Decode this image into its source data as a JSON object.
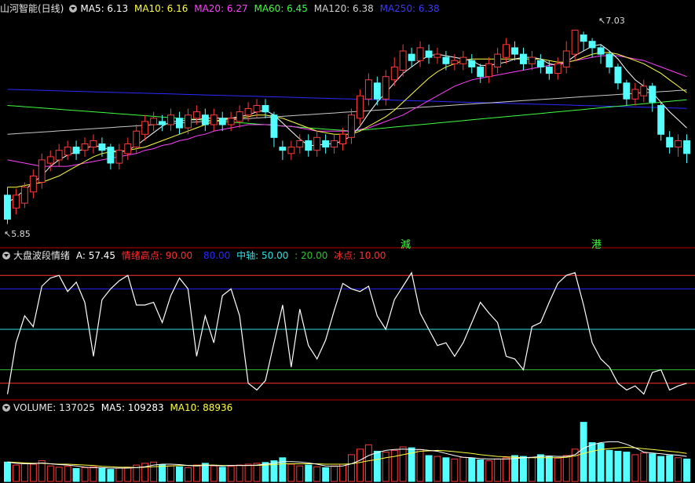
{
  "colors": {
    "up": "#ff3b3b",
    "down": "#54ffff",
    "ma5": "#ffffff",
    "ma10": "#ffff40",
    "ma20": "#ff40ff",
    "ma60": "#40ff40",
    "ma120": "#c8c8c8",
    "ma250": "#2a2aff",
    "line": "#ffffff",
    "hi": "#ff3030",
    "blue": "#2020ff",
    "mid": "#30e0e0",
    "green": "#30c030",
    "ice": "#ff3030"
  },
  "price_header": {
    "title": "山河智能(日线)",
    "ma5": "MA5: 6.13",
    "ma10": "MA10: 6.16",
    "ma20": "MA20: 6.27",
    "ma60": "MA60: 6.45",
    "ma120": "MA120: 6.38",
    "ma250": "MA250: 6.38"
  },
  "osc_header": {
    "title": "大盘波段情绪",
    "a": "A: 57.45",
    "high": "情绪高点: 90.00",
    "blue": "80.00",
    "mid": "中轴: 50.00",
    "green": ": 20.00",
    "ice": "冰点: 10.00"
  },
  "vol_header": {
    "title": "VOLUME: 137025",
    "ma5": "MA5: 109283",
    "ma10": "MA10: 88936"
  },
  "annotations": {
    "high_label": "7.03",
    "low_label": "5.85",
    "marker1": "減",
    "marker2": "港"
  },
  "chart_data": [
    {
      "type": "candlestick",
      "ylim": [
        5.75,
        7.12
      ],
      "candles": [
        [
          6.0,
          5.85,
          6.05,
          5.82
        ],
        [
          5.92,
          6.0,
          6.04,
          5.88
        ],
        [
          5.95,
          6.05,
          6.08,
          5.92
        ],
        [
          6.02,
          6.12,
          6.16,
          5.98
        ],
        [
          6.08,
          6.22,
          6.26,
          6.04
        ],
        [
          6.2,
          6.24,
          6.28,
          6.15
        ],
        [
          6.22,
          6.28,
          6.32,
          6.18
        ],
        [
          6.25,
          6.3,
          6.34,
          6.22
        ],
        [
          6.3,
          6.26,
          6.34,
          6.22
        ],
        [
          6.28,
          6.32,
          6.36,
          6.24
        ],
        [
          6.3,
          6.34,
          6.38,
          6.26
        ],
        [
          6.32,
          6.28,
          6.36,
          6.24
        ],
        [
          6.3,
          6.2,
          6.32,
          6.16
        ],
        [
          6.2,
          6.28,
          6.32,
          6.16
        ],
        [
          6.26,
          6.32,
          6.36,
          6.22
        ],
        [
          6.3,
          6.4,
          6.44,
          6.26
        ],
        [
          6.38,
          6.46,
          6.5,
          6.34
        ],
        [
          6.44,
          6.48,
          6.52,
          6.4
        ],
        [
          6.46,
          6.44,
          6.5,
          6.4
        ],
        [
          6.44,
          6.5,
          6.54,
          6.4
        ],
        [
          6.48,
          6.42,
          6.52,
          6.38
        ],
        [
          6.42,
          6.5,
          6.54,
          6.38
        ],
        [
          6.48,
          6.52,
          6.56,
          6.44
        ],
        [
          6.5,
          6.44,
          6.54,
          6.4
        ],
        [
          6.44,
          6.5,
          6.54,
          6.4
        ],
        [
          6.48,
          6.44,
          6.52,
          6.4
        ],
        [
          6.44,
          6.48,
          6.52,
          6.4
        ],
        [
          6.46,
          6.52,
          6.56,
          6.42
        ],
        [
          6.5,
          6.54,
          6.58,
          6.46
        ],
        [
          6.52,
          6.56,
          6.6,
          6.48
        ],
        [
          6.56,
          6.52,
          6.6,
          6.48
        ],
        [
          6.5,
          6.36,
          6.52,
          6.3
        ],
        [
          6.3,
          6.28,
          6.34,
          6.22
        ],
        [
          6.26,
          6.3,
          6.34,
          6.22
        ],
        [
          6.3,
          6.34,
          6.38,
          6.26
        ],
        [
          6.34,
          6.28,
          6.38,
          6.24
        ],
        [
          6.28,
          6.36,
          6.4,
          6.24
        ],
        [
          6.34,
          6.3,
          6.38,
          6.26
        ],
        [
          6.3,
          6.34,
          6.38,
          6.26
        ],
        [
          6.32,
          6.38,
          6.42,
          6.28
        ],
        [
          6.36,
          6.5,
          6.54,
          6.32
        ],
        [
          6.48,
          6.62,
          6.66,
          6.44
        ],
        [
          6.6,
          6.72,
          6.76,
          6.56
        ],
        [
          6.7,
          6.6,
          6.74,
          6.56
        ],
        [
          6.6,
          6.74,
          6.78,
          6.56
        ],
        [
          6.72,
          6.8,
          6.86,
          6.68
        ],
        [
          6.78,
          6.9,
          6.94,
          6.74
        ],
        [
          6.88,
          6.84,
          6.92,
          6.8
        ],
        [
          6.84,
          6.92,
          6.96,
          6.8
        ],
        [
          6.9,
          6.86,
          6.94,
          6.82
        ],
        [
          6.86,
          6.88,
          6.92,
          6.82
        ],
        [
          6.86,
          6.82,
          6.9,
          6.78
        ],
        [
          6.82,
          6.84,
          6.88,
          6.78
        ],
        [
          6.82,
          6.86,
          6.9,
          6.78
        ],
        [
          6.84,
          6.8,
          6.88,
          6.76
        ],
        [
          6.8,
          6.74,
          6.82,
          6.7
        ],
        [
          6.74,
          6.82,
          6.86,
          6.7
        ],
        [
          6.8,
          6.88,
          6.92,
          6.76
        ],
        [
          6.86,
          6.94,
          6.98,
          6.82
        ],
        [
          6.92,
          6.88,
          6.96,
          6.84
        ],
        [
          6.88,
          6.82,
          6.92,
          6.78
        ],
        [
          6.82,
          6.86,
          6.9,
          6.78
        ],
        [
          6.84,
          6.8,
          6.88,
          6.76
        ],
        [
          6.8,
          6.76,
          6.84,
          6.72
        ],
        [
          6.76,
          6.82,
          6.86,
          6.72
        ],
        [
          6.8,
          6.9,
          6.96,
          6.76
        ],
        [
          6.88,
          7.03,
          7.03,
          6.84
        ],
        [
          7.0,
          6.96,
          7.02,
          6.9
        ],
        [
          6.96,
          6.92,
          6.98,
          6.86
        ],
        [
          6.92,
          6.88,
          6.94,
          6.82
        ],
        [
          6.88,
          6.8,
          6.9,
          6.76
        ],
        [
          6.8,
          6.7,
          6.82,
          6.66
        ],
        [
          6.7,
          6.6,
          6.72,
          6.56
        ],
        [
          6.6,
          6.66,
          6.7,
          6.56
        ],
        [
          6.62,
          6.68,
          6.72,
          6.58
        ],
        [
          6.68,
          6.58,
          6.7,
          6.52
        ],
        [
          6.56,
          6.38,
          6.58,
          6.34
        ],
        [
          6.36,
          6.3,
          6.4,
          6.26
        ],
        [
          6.3,
          6.34,
          6.38,
          6.24
        ],
        [
          6.34,
          6.26,
          6.38,
          6.2
        ]
      ],
      "ma5": [
        5.95,
        5.99,
        6.03,
        6.08,
        6.12,
        6.18,
        6.22,
        6.25,
        6.27,
        6.29,
        6.31,
        6.3,
        6.28,
        6.27,
        6.28,
        6.31,
        6.35,
        6.39,
        6.43,
        6.46,
        6.46,
        6.47,
        6.47,
        6.48,
        6.48,
        6.48,
        6.48,
        6.49,
        6.5,
        6.52,
        6.53,
        6.5,
        6.45,
        6.4,
        6.35,
        6.31,
        6.31,
        6.32,
        6.32,
        6.34,
        6.37,
        6.43,
        6.51,
        6.58,
        6.64,
        6.7,
        6.76,
        6.8,
        6.84,
        6.87,
        6.88,
        6.87,
        6.86,
        6.85,
        6.84,
        6.81,
        6.81,
        6.82,
        6.83,
        6.85,
        6.86,
        6.86,
        6.85,
        6.82,
        6.81,
        6.83,
        6.87,
        6.9,
        6.93,
        6.94,
        6.9,
        6.85,
        6.78,
        6.72,
        6.68,
        6.64,
        6.58,
        6.52,
        6.47,
        6.42
      ],
      "ma10": [
        6.05,
        6.05,
        6.06,
        6.07,
        6.08,
        6.1,
        6.12,
        6.15,
        6.18,
        6.21,
        6.24,
        6.26,
        6.27,
        6.27,
        6.28,
        6.29,
        6.3,
        6.32,
        6.34,
        6.36,
        6.38,
        6.4,
        6.42,
        6.44,
        6.46,
        6.47,
        6.48,
        6.48,
        6.49,
        6.5,
        6.5,
        6.49,
        6.48,
        6.46,
        6.44,
        6.42,
        6.4,
        6.39,
        6.38,
        6.38,
        6.38,
        6.4,
        6.43,
        6.46,
        6.49,
        6.53,
        6.58,
        6.63,
        6.68,
        6.73,
        6.77,
        6.8,
        6.82,
        6.84,
        6.85,
        6.85,
        6.85,
        6.85,
        6.85,
        6.85,
        6.85,
        6.85,
        6.85,
        6.84,
        6.83,
        6.83,
        6.84,
        6.86,
        6.88,
        6.89,
        6.89,
        6.88,
        6.86,
        6.84,
        6.82,
        6.79,
        6.76,
        6.72,
        6.68,
        6.64
      ],
      "ma20": [
        6.22,
        6.21,
        6.2,
        6.19,
        6.18,
        6.18,
        6.18,
        6.18,
        6.19,
        6.2,
        6.21,
        6.22,
        6.23,
        6.24,
        6.25,
        6.26,
        6.28,
        6.29,
        6.31,
        6.32,
        6.34,
        6.35,
        6.37,
        6.38,
        6.4,
        6.41,
        6.42,
        6.43,
        6.44,
        6.44,
        6.44,
        6.44,
        6.43,
        6.43,
        6.42,
        6.41,
        6.4,
        6.4,
        6.4,
        6.4,
        6.4,
        6.41,
        6.42,
        6.44,
        6.46,
        6.48,
        6.5,
        6.53,
        6.56,
        6.59,
        6.62,
        6.65,
        6.68,
        6.7,
        6.72,
        6.73,
        6.74,
        6.75,
        6.76,
        6.77,
        6.78,
        6.79,
        6.8,
        6.81,
        6.82,
        6.83,
        6.84,
        6.85,
        6.86,
        6.87,
        6.87,
        6.87,
        6.86,
        6.85,
        6.84,
        6.82,
        6.8,
        6.78,
        6.76,
        6.74
      ]
    },
    {
      "type": "line",
      "name": "A",
      "ylim": [
        0,
        100
      ],
      "reference_lines": [
        90,
        80,
        50,
        20,
        10
      ],
      "values": [
        2,
        40,
        60,
        52,
        82,
        88,
        90,
        78,
        85,
        70,
        30,
        72,
        80,
        86,
        90,
        68,
        68,
        70,
        55,
        75,
        88,
        80,
        30,
        60,
        40,
        75,
        80,
        60,
        10,
        5,
        12,
        40,
        68,
        22,
        65,
        38,
        28,
        42,
        64,
        84,
        80,
        78,
        82,
        60,
        50,
        72,
        82,
        92,
        62,
        50,
        38,
        40,
        30,
        40,
        55,
        70,
        62,
        55,
        30,
        28,
        20,
        52,
        55,
        70,
        84,
        90,
        92,
        68,
        40,
        28,
        22,
        10,
        5,
        8,
        2,
        18,
        20,
        5,
        8,
        10
      ]
    },
    {
      "type": "bar",
      "name": "VOLUME",
      "ylim": [
        0,
        160000
      ],
      "values": [
        45000,
        38000,
        42000,
        40000,
        48000,
        36000,
        33000,
        35000,
        30000,
        32000,
        34000,
        30000,
        28000,
        31000,
        33000,
        38000,
        42000,
        45000,
        39000,
        36000,
        34000,
        32000,
        38000,
        42000,
        36000,
        33000,
        35000,
        38000,
        40000,
        42000,
        44000,
        48000,
        55000,
        40000,
        36000,
        38000,
        34000,
        32000,
        36000,
        40000,
        62000,
        75000,
        85000,
        70000,
        68000,
        72000,
        80000,
        78000,
        74000,
        60000,
        58000,
        55000,
        52000,
        56000,
        54000,
        50000,
        48000,
        52000,
        55000,
        60000,
        58000,
        56000,
        62000,
        58000,
        54000,
        60000,
        75000,
        137025,
        90000,
        88000,
        72000,
        70000,
        68000,
        62000,
        66000,
        64000,
        58000,
        60000,
        55000,
        52000
      ],
      "ma5": [
        45000,
        42000,
        41000,
        41000,
        43000,
        41000,
        39000,
        38000,
        36000,
        33000,
        32000,
        32000,
        31000,
        31000,
        31000,
        32000,
        34000,
        38000,
        40000,
        40000,
        39000,
        37000,
        36000,
        37000,
        37000,
        36000,
        37000,
        37000,
        37000,
        38000,
        40000,
        42000,
        46000,
        46000,
        45000,
        43000,
        40000,
        36000,
        35000,
        36000,
        41000,
        49000,
        60000,
        67000,
        72000,
        74000,
        75000,
        74000,
        74000,
        72000,
        70000,
        65000,
        60000,
        56000,
        55000,
        53000,
        52000,
        52000,
        52000,
        53000,
        55000,
        56000,
        58000,
        59000,
        58000,
        58000,
        62000,
        77000,
        85000,
        90000,
        92000,
        92000,
        86000,
        78000,
        68000,
        66000,
        64000,
        62000,
        61000,
        58000
      ],
      "ma10": [
        45000,
        44000,
        43000,
        42000,
        42000,
        41000,
        40000,
        40000,
        39000,
        38000,
        37000,
        35000,
        34000,
        33000,
        33000,
        32000,
        33000,
        34000,
        35000,
        36000,
        37000,
        37000,
        37000,
        38000,
        38000,
        37000,
        37000,
        37000,
        37000,
        37000,
        38000,
        39000,
        41000,
        41000,
        41000,
        41000,
        41000,
        40000,
        40000,
        40000,
        41000,
        44000,
        48000,
        51000,
        55000,
        58000,
        62000,
        66000,
        70000,
        71000,
        72000,
        71000,
        69000,
        67000,
        65000,
        62000,
        60000,
        58000,
        57000,
        56000,
        55000,
        55000,
        55000,
        55000,
        55000,
        56000,
        59000,
        65000,
        70000,
        74000,
        76000,
        78000,
        79000,
        78000,
        76000,
        74000,
        72000,
        70000,
        68000,
        65000
      ]
    }
  ]
}
